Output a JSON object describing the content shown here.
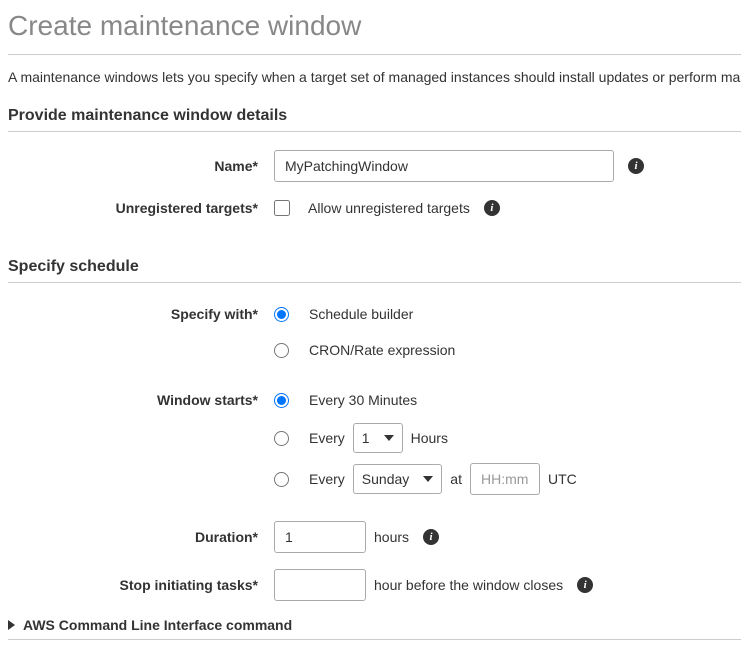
{
  "page": {
    "title": "Create maintenance window",
    "description": "A maintenance windows lets you specify when a target set of managed instances should install updates or perform ma"
  },
  "section_details": {
    "heading": "Provide maintenance window details",
    "name_label": "Name*",
    "name_value": "MyPatchingWindow",
    "unregistered_label": "Unregistered targets*",
    "unregistered_checkbox_label": "Allow unregistered targets"
  },
  "section_schedule": {
    "heading": "Specify schedule",
    "specify_with_label": "Specify with*",
    "specify_with_options": {
      "builder": "Schedule builder",
      "cron": "CRON/Rate expression"
    },
    "window_starts_label": "Window starts*",
    "window_options": {
      "every_30": "Every 30 Minutes",
      "every_prefix": "Every",
      "hours_value": "1",
      "hours_suffix": "Hours",
      "day_value": "Sunday",
      "at_label": "at",
      "time_placeholder": "HH:mm",
      "utc_label": "UTC"
    },
    "duration_label": "Duration*",
    "duration_value": "1",
    "duration_suffix": "hours",
    "stop_label": "Stop initiating tasks*",
    "stop_value": "",
    "stop_suffix": "hour before the window closes"
  },
  "cli_section": {
    "label": "AWS Command Line Interface command"
  }
}
